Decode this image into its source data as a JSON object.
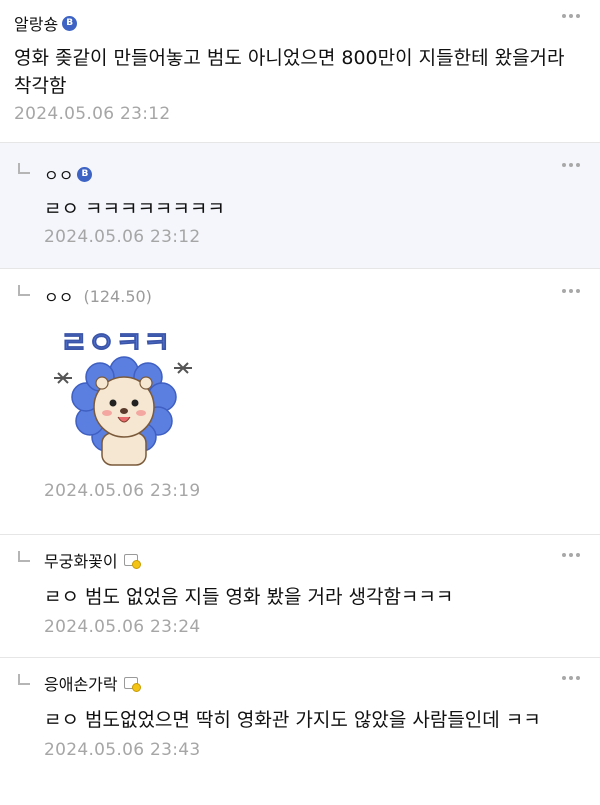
{
  "comments": [
    {
      "author": "알랑숑",
      "badge": "B",
      "text": "영화 좆같이 만들어놓고 범도 아니었으면 800만이 지들한테 왔을거라 착각함",
      "date": "2024.05.06 23:12"
    },
    {
      "author": "ㅇㅇ",
      "badge": "B",
      "text": "ㄹㅇ ㅋㅋㅋㅋㅋㅋㅋㅋ",
      "date": "2024.05.06 23:12"
    },
    {
      "author": "ㅇㅇ",
      "ip": "(124.50)",
      "sticker_text": "ㄹㅇㅋㅋ",
      "date": "2024.05.06 23:19"
    },
    {
      "author": "무궁화꽃이",
      "text": "ㄹㅇ 범도 없었음 지들 영화 봤을 거라 생각함ㅋㅋㅋ",
      "date": "2024.05.06 23:24"
    },
    {
      "author": "응애손가락",
      "text": "ㄹㅇ 범도없었으면 딱히 영화관 가지도 않았을 사람들인데 ㅋㅋ",
      "date": "2024.05.06 23:43"
    }
  ],
  "colors": {
    "badge_blue": "#3d63c4",
    "highlight_bg": "#f4f6fb",
    "date_gray": "#a6a6a6",
    "sticker_blue": "#5b7fe0"
  },
  "icons": [
    "more-options-icon",
    "reply-arrow-icon",
    "gallery-badge-icon",
    "image-badge-icon"
  ]
}
